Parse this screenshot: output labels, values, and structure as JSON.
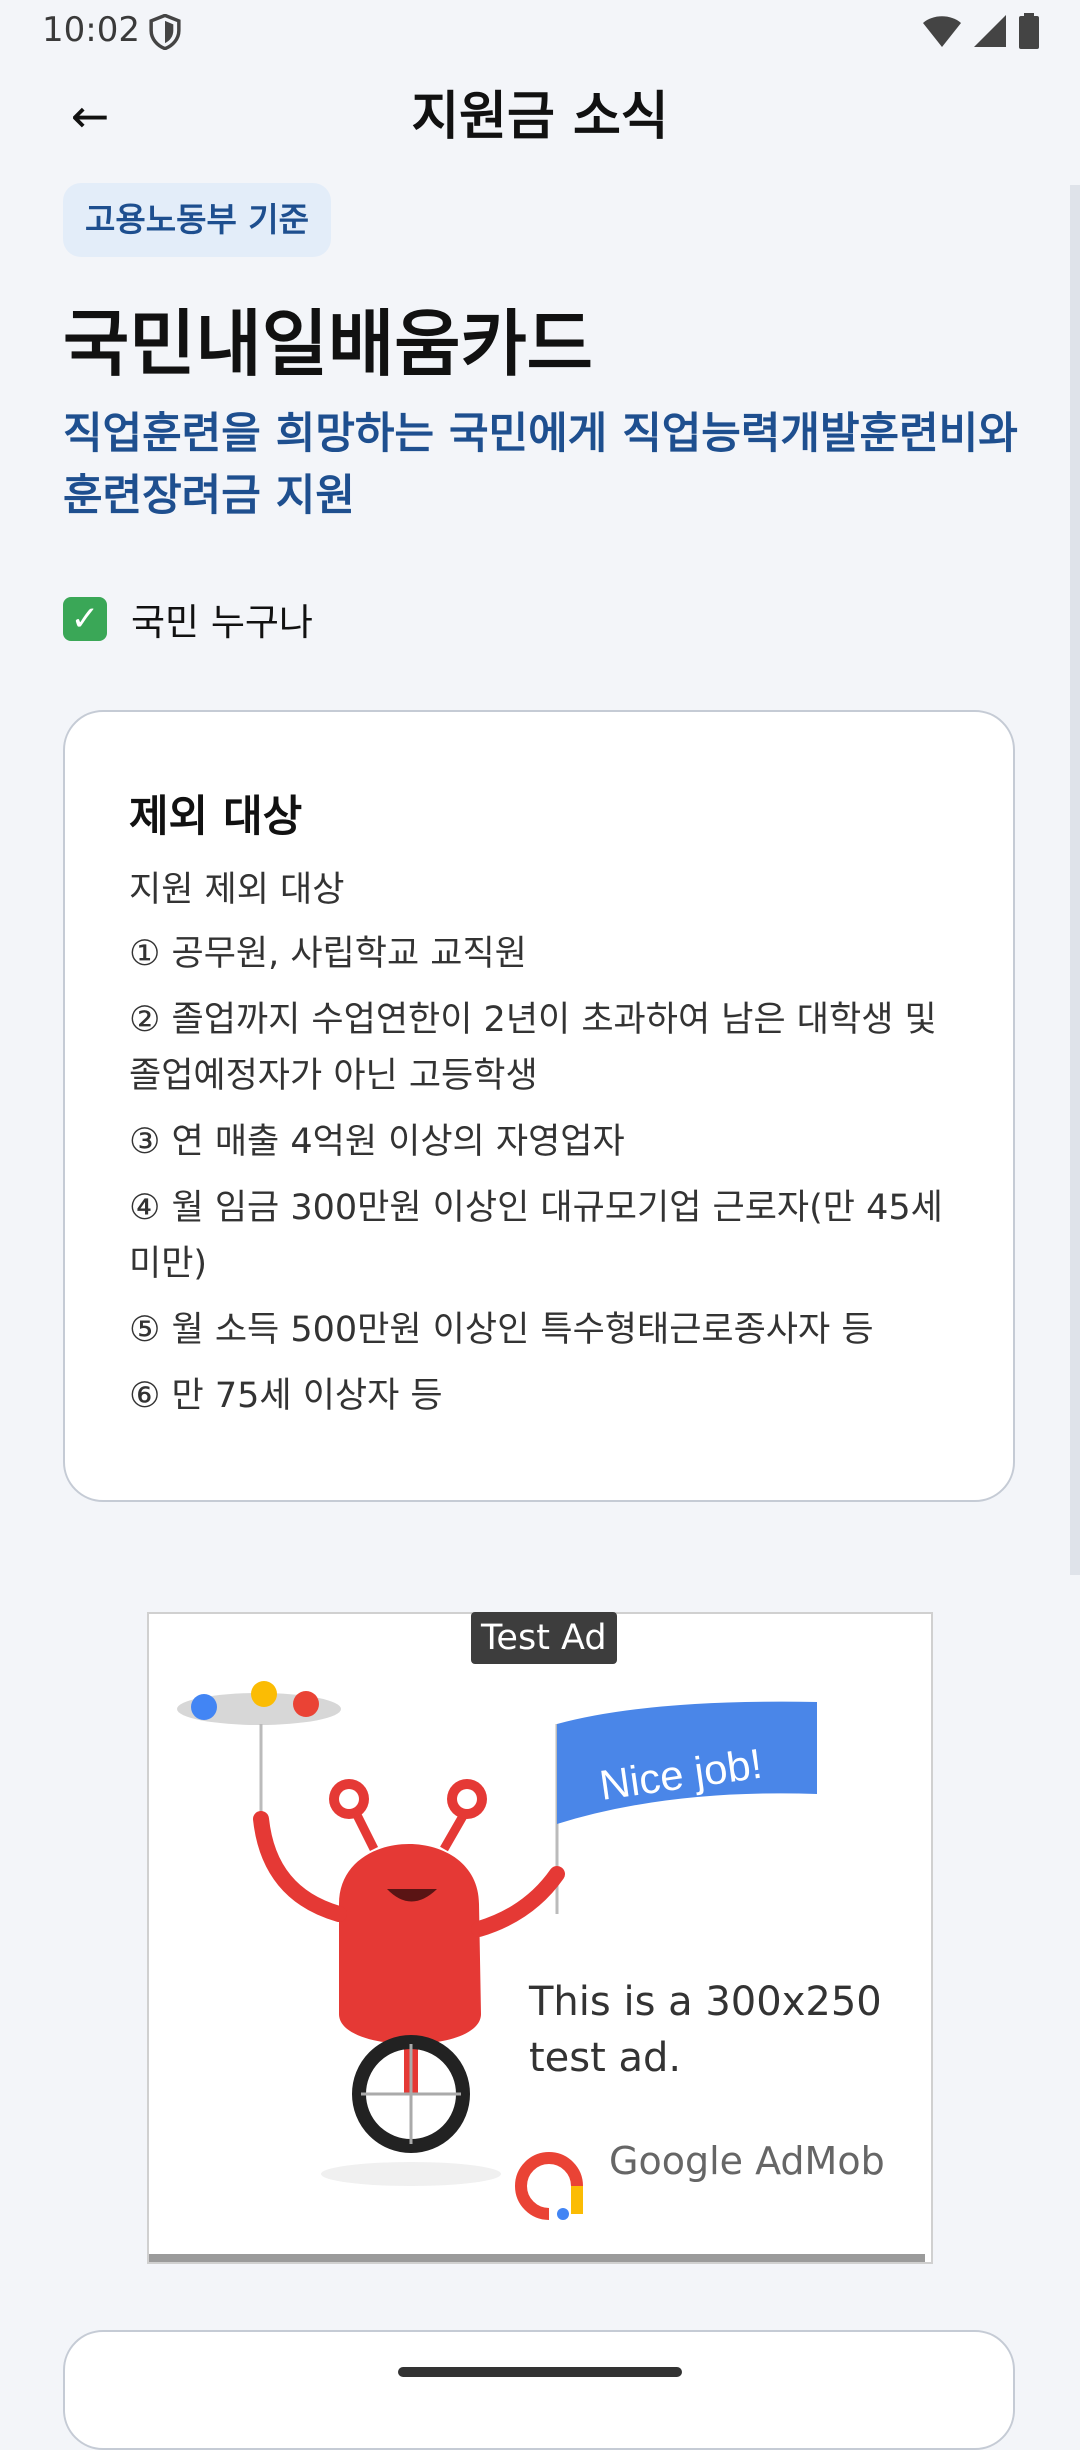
{
  "status_bar": {
    "time": "10:02"
  },
  "app_bar": {
    "back_symbol": "←",
    "title": "지원금 소식"
  },
  "tag": "고용노동부 기준",
  "card_name": "국민내일배움카드",
  "subtitle": "직업훈련을 희망하는 국민에게 직업능력개발훈련비와 훈련장려금 지원",
  "eligibility": {
    "icon": "check-mark-icon",
    "check_symbol": "✓",
    "text": "국민 누구나"
  },
  "exclusion_card": {
    "heading": "제외 대상",
    "intro": "지원 제외 대상",
    "items": [
      "① 공무원, 사립학교 교직원",
      "② 졸업까지 수업연한이 2년이 초과하여 남은 대학생 및 졸업예정자가 아닌 고등학생",
      "③ 연 매출 4억원 이상의 자영업자",
      "④ 월 임금 300만원 이상인 대규모기업 근로자(만 45세 미만)",
      "⑤ 월 소득 500만원 이상인 특수형태근로종사자 등",
      "⑥ 만 75세 이상자 등"
    ]
  },
  "ad": {
    "badge": "Test Ad",
    "flag_text": "Nice job!",
    "text": "This is a 300x250 test ad.",
    "brand": "Google AdMob"
  },
  "colors": {
    "accent": "#1e4f8f",
    "tag_bg": "#e3edf9",
    "background": "#f3f5f9",
    "check": "#3aa757"
  }
}
